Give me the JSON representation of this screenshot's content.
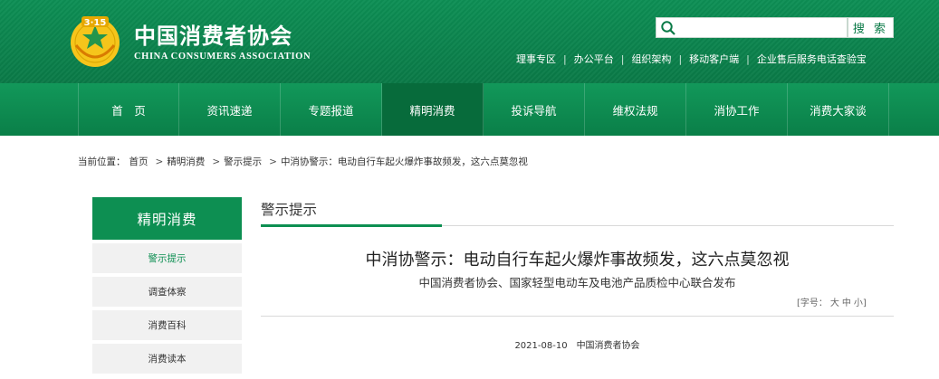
{
  "header": {
    "brand_cn": "中国消费者协会",
    "brand_en": "CHINA CONSUMERS ASSOCIATION",
    "logo_text": "3·15",
    "search": {
      "placeholder": "",
      "button_label": "搜 索"
    },
    "top_links": [
      "理事专区",
      "办公平台",
      "组织架构",
      "移动客户端",
      "企业售后服务电话查验宝"
    ],
    "separator": "|"
  },
  "nav": {
    "items": [
      {
        "label": "首　页",
        "active": false
      },
      {
        "label": "资讯速递",
        "active": false
      },
      {
        "label": "专题报道",
        "active": false
      },
      {
        "label": "精明消费",
        "active": true
      },
      {
        "label": "投诉导航",
        "active": false
      },
      {
        "label": "维权法规",
        "active": false
      },
      {
        "label": "消协工作",
        "active": false
      },
      {
        "label": "消费大家谈",
        "active": false
      }
    ]
  },
  "breadcrumb": {
    "prefix": "当前位置：",
    "items": [
      "首页",
      "精明消费",
      "警示提示",
      "中消协警示：电动自行车起火爆炸事故频发，这六点莫忽视"
    ],
    "arrow": ">"
  },
  "sidebar": {
    "title": "精明消费",
    "items": [
      {
        "label": "警示提示",
        "active": true
      },
      {
        "label": "调查体察",
        "active": false
      },
      {
        "label": "消费百科",
        "active": false
      },
      {
        "label": "消费读本",
        "active": false
      }
    ]
  },
  "content": {
    "section_title": "警示提示",
    "article_title": "中消协警示：电动自行车起火爆炸事故频发，这六点莫忽视",
    "article_subtitle": "中国消费者协会、国家轻型电动车及电池产品质检中心联合发布",
    "font_size_label": "[字号：",
    "font_size_options": [
      "大",
      "中",
      "小"
    ],
    "font_size_end": "]",
    "date": "2021-08-10",
    "source": "中国消费者协会"
  },
  "colors": {
    "brand_green": "#0d8f52",
    "nav_active": "#076b3b"
  }
}
